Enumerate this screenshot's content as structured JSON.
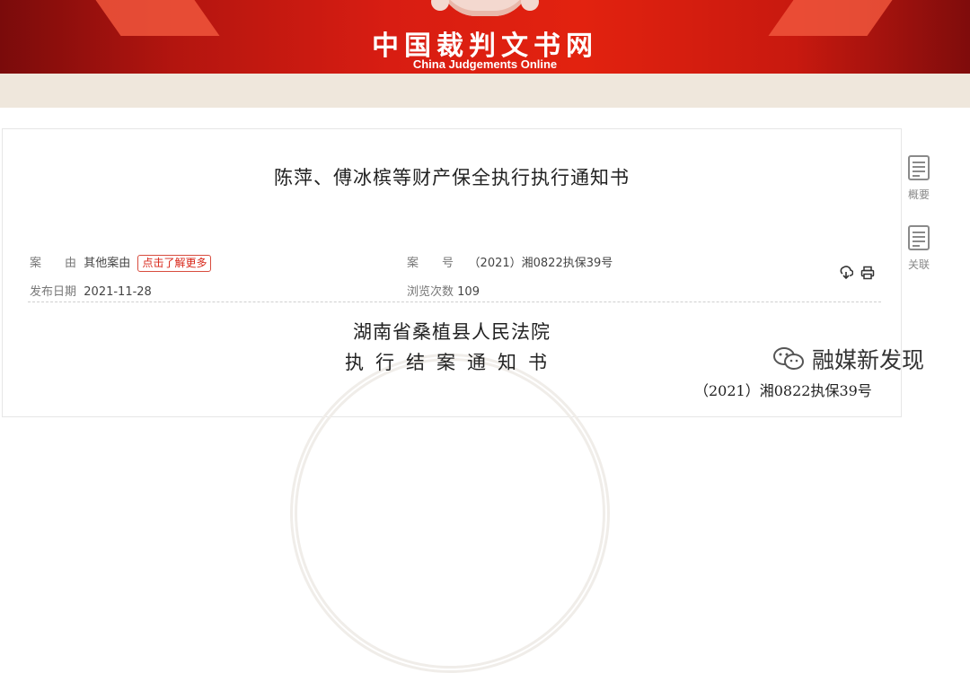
{
  "header": {
    "title": "中国裁判文书网",
    "subtitle": "China Judgements Online"
  },
  "document": {
    "title": "陈萍、傅冰槟等财产保全执行执行通知书",
    "meta": {
      "cause_key": "案　　由",
      "cause_value": "其他案由",
      "learn_more": "点击了解更多",
      "case_no_key": "案　　号",
      "case_no_value": "（2021）湘0822执保39号",
      "date_key": "发布日期",
      "date_value": "2021-11-28",
      "views_key": "浏览次数",
      "views_value": "109"
    },
    "body": {
      "court": "湖南省桑植县人民法院",
      "doc_type": "执行结案通知书",
      "case_number": "（2021）湘0822执保39号"
    }
  },
  "sidebar": {
    "items": [
      {
        "label": "概要",
        "icon": "summary-icon"
      },
      {
        "label": "关联",
        "icon": "related-icon"
      }
    ]
  },
  "overlay": {
    "source_label": "融媒新发现"
  },
  "colors": {
    "brand_red": "#d81d12",
    "tag_red": "#d8271a",
    "strip": "#efe7dc"
  }
}
